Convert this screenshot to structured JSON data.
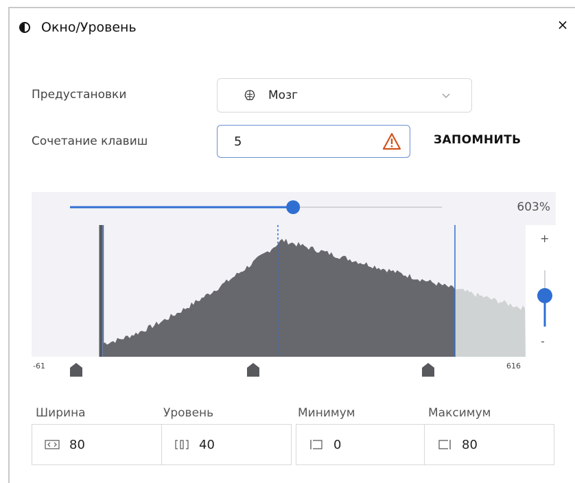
{
  "window": {
    "title": "Окно/Уровень",
    "close_label": "×"
  },
  "presets": {
    "label": "Предустановки",
    "value": "Мозг",
    "icon": "brain-icon"
  },
  "shortcut": {
    "label": "Сочетание клавиш",
    "value": "5",
    "warning_icon": "warning-icon",
    "remember_label": "ЗАПОМНИТЬ"
  },
  "histogram": {
    "zoom_percent": "603%",
    "zoom_fraction": 0.6,
    "vertical_zoom_fraction": 0.55,
    "range_min_label": "-61",
    "range_max_label": "616",
    "plus_label": "+",
    "minus_label": "-",
    "colors": {
      "selected": "#67686d",
      "unselected": "#cfd3d3",
      "background": "#f3f2f6",
      "accent": "#2f6fd2"
    }
  },
  "fields": {
    "width": {
      "label": "Ширина",
      "value": "80",
      "icon": "width-icon"
    },
    "level": {
      "label": "Уровень",
      "value": "40",
      "icon": "level-icon"
    },
    "minimum": {
      "label": "Минимум",
      "value": "0",
      "icon": "minimum-icon"
    },
    "maximum": {
      "label": "Максимум",
      "value": "80",
      "icon": "maximum-icon"
    }
  }
}
